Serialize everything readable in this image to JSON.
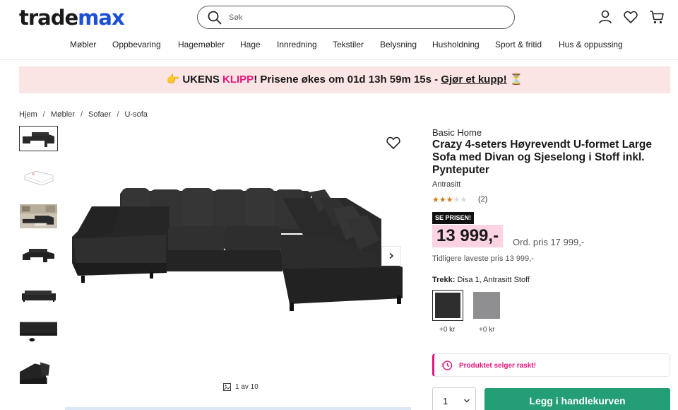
{
  "header": {
    "logo_part1": "trade",
    "logo_part2": "max",
    "search_placeholder": "Søk",
    "icons": [
      "user-icon",
      "heart-icon",
      "cart-icon"
    ]
  },
  "nav": {
    "items": [
      "Møbler",
      "Oppbevaring",
      "Hagemøbler",
      "Hage",
      "Innredning",
      "Tekstiler",
      "Belysning",
      "Husholdning",
      "Sport & fritid",
      "Hus & oppussing"
    ]
  },
  "promo": {
    "emoji": "👉",
    "part1": " UKENS ",
    "highlight": "KLIPP",
    "part2": "! Prisene økes om 01d 13h 59m 15s - ",
    "link": "Gjør et kupp!",
    "end_emoji": " ⏳"
  },
  "breadcrumb": [
    "Hjem",
    "Møbler",
    "Sofaer",
    "U-sofa"
  ],
  "gallery": {
    "counter": "1 av 10",
    "thumb_count": 7
  },
  "product": {
    "brand": "Basic Home",
    "title": "Crazy 4-seters Høyrevendt U-formet Large Sofa med Divan og Sjeselong i Stoff inkl. Pynteputer",
    "variant": "Antrasitt",
    "rating": 3,
    "rating_max": 5,
    "review_count": "(2)",
    "badge": "SE PRISEN!",
    "price": "13 999,-",
    "original_price": "Ord. pris 17 999,-",
    "previous_lowest": "Tidligere laveste pris 13 999,-",
    "cover_label": "Trekk:",
    "cover_value": " Disa 1, Antrasitt Stoff",
    "swatches": [
      {
        "price": "+0 kr",
        "color": "#2e2e2e",
        "selected": true
      },
      {
        "price": "+0 kr",
        "color": "#8f8f91",
        "selected": false
      }
    ],
    "alert": "Produktet selger raskt!",
    "quantity": "1",
    "add_to_cart": "Legg i handlekurven"
  },
  "colors": {
    "brand_accent": "#1a4fd6",
    "pink": "#e6157c",
    "promo_bg": "#fbe4e4",
    "price_bg": "#fbd3e2",
    "cta_green": "#239e76"
  }
}
